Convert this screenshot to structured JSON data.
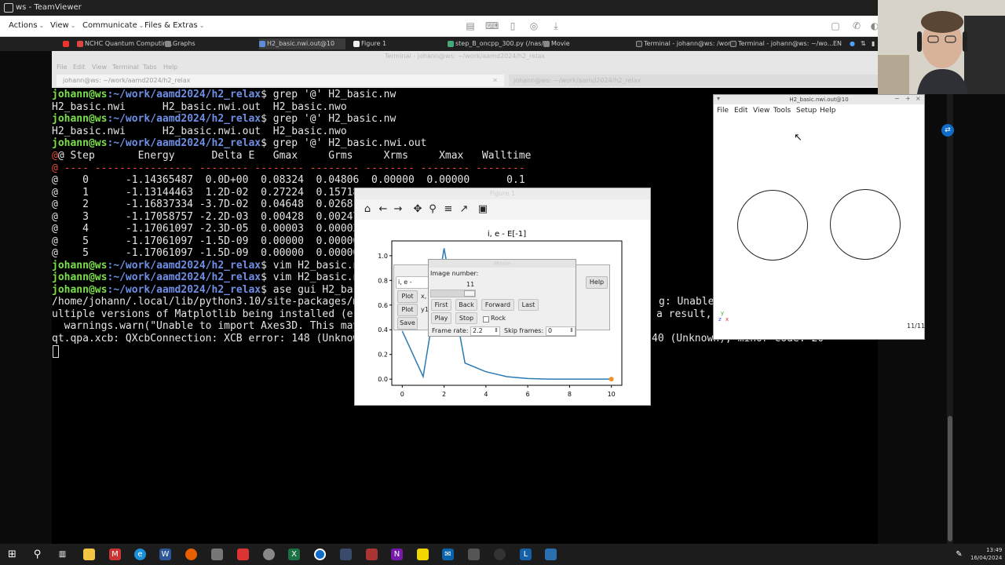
{
  "teamviewer": {
    "window_title": "ws - TeamViewer",
    "menu": [
      "Actions",
      "View",
      "Communicate",
      "Files & Extras"
    ]
  },
  "remote_tabs": [
    "NCHC Quantum Computin...",
    "Graphs",
    "H2_basic.nwi.out@10",
    "Figure 1",
    "step_B_oncpp_300.py (/nas/...",
    "Movie",
    "Terminal - johann@ws: /wor...",
    "Terminal - johann@ws: ~/wo..."
  ],
  "tray_lang": "EN",
  "terminal": {
    "window_title": "Terminal - johann@ws: ~/work/aamd2024/h2_relax",
    "menu": [
      "File",
      "Edit",
      "View",
      "Terminal",
      "Tabs",
      "Help"
    ],
    "tab1": "johann@ws: ~/work/aamd2024/h2_relax",
    "tab2": "johann@ws: ~/work/aamd2024/h2_relax",
    "prompt_user": "johann@ws",
    "prompt_path": ":~/work/aamd2024/h2_relax",
    "lines": {
      "cmd1": "$ grep '@' H2_basic.nw",
      "out1": "H2_basic.nwi      H2_basic.nwi.out  H2_basic.nwo",
      "cmd2": "$ grep '@' H2_basic.nw",
      "out2": "H2_basic.nwi      H2_basic.nwi.out  H2_basic.nwo",
      "cmd3": "$ grep '@' H2_basic.nwi.out",
      "hdr": "@ Step       Energy      Delta E   Gmax     Grms     Xrms     Xmax   Walltime",
      "sep": "@ ---- ---------------- -------- -------- -------- -------- -------- --------",
      "r0": "@    0      -1.14365487  0.0D+00  0.08324  0.04806  0.00000  0.00000      0.1",
      "r1": "@    1      -1.13144463  1.2D-02  0.27224  0.15718",
      "r2": "@    2      -1.16837334 -3.7D-02  0.04648  0.02681",
      "r3": "@    3      -1.17058757 -2.2D-03  0.00428  0.00247",
      "r4": "@    4      -1.17061097 -2.3D-05  0.00003  0.00002",
      "r5": "@    5      -1.17061097 -1.5D-09  0.00000  0.00000",
      "r6": "@    5      -1.17061097 -1.5D-09  0.00000  0.00000",
      "cmd4": "$ vim H2_basic.n",
      "cmd5": "$ vim H2_basic.n",
      "cmd6": "$ ase gui H2_bas",
      "w1a": "/home/johann/.local/lib/python3.10/site-packages/m",
      "w1b": "g: Unable",
      "w1c": "o m",
      "w2a": "ultiple versions of Matplotlib being installed (e",
      "w2b": "a result,",
      "w3": "  warnings.warn(\"Unable to import Axes3D. This may",
      "w4a": "qt.qpa.xcb: QXcbConnection: XCB error: 148 (Unknow",
      "w4b": "40 (Unknown), minor code: 20"
    }
  },
  "ase_window": {
    "title": "H2_basic.nwi.out@10",
    "menu": [
      "File",
      "Edit",
      "View",
      "Tools",
      "Setup",
      "Help"
    ],
    "frame": "11/11",
    "axes_x": "x",
    "axes_y": "y",
    "axes_z": "z"
  },
  "figure": {
    "window_title": "Figure 1",
    "toolbar_icons": [
      "home-icon",
      "back-arrow-icon",
      "forward-arrow-icon",
      "pan-icon",
      "zoom-icon",
      "configure-subplots-icon",
      "edit-axis-icon",
      "save-icon"
    ]
  },
  "chart_data": {
    "type": "line",
    "title": "i, e - E[-1]",
    "x": [
      0,
      1,
      2,
      3,
      4,
      5,
      6,
      7,
      8,
      9,
      10
    ],
    "series": [
      {
        "values": [
          0.39,
          0.02,
          1.06,
          0.13,
          0.06,
          0.02,
          0.005,
          0.0,
          0.0,
          0.0,
          0.0
        ],
        "color": "#2a7ab0"
      }
    ],
    "highlight_point": {
      "x": 10,
      "y": 0.0,
      "color": "#f0922b"
    },
    "xticks": [
      "0",
      "2",
      "4",
      "6",
      "8",
      "10"
    ],
    "yticks": [
      "0.0",
      "0.2",
      "0.4",
      "0.6",
      "0.8",
      "1.0"
    ],
    "xlim": [
      -0.5,
      10.5
    ],
    "ylim": [
      -0.05,
      1.12
    ]
  },
  "control_panel": {
    "expr_value": "i, e - E[-1]",
    "plot1": "Plot",
    "plot2": "Plot",
    "x_label": "x,",
    "y_label": "y1",
    "save": "Save",
    "help": "Help"
  },
  "movie": {
    "window_title": "Movie",
    "image_number_label": "Image number:",
    "image_number": "11",
    "first": "First",
    "back": "Back",
    "forward": "Forward",
    "last": "Last",
    "play": "Play",
    "stop": "Stop",
    "rock": "Rock",
    "frame_rate_label": "Frame rate:",
    "frame_rate": "2.2",
    "skip_frames_label": "Skip frames:",
    "skip_frames": "0"
  },
  "clock": {
    "time": "13:49",
    "date": "16/04/2024"
  }
}
